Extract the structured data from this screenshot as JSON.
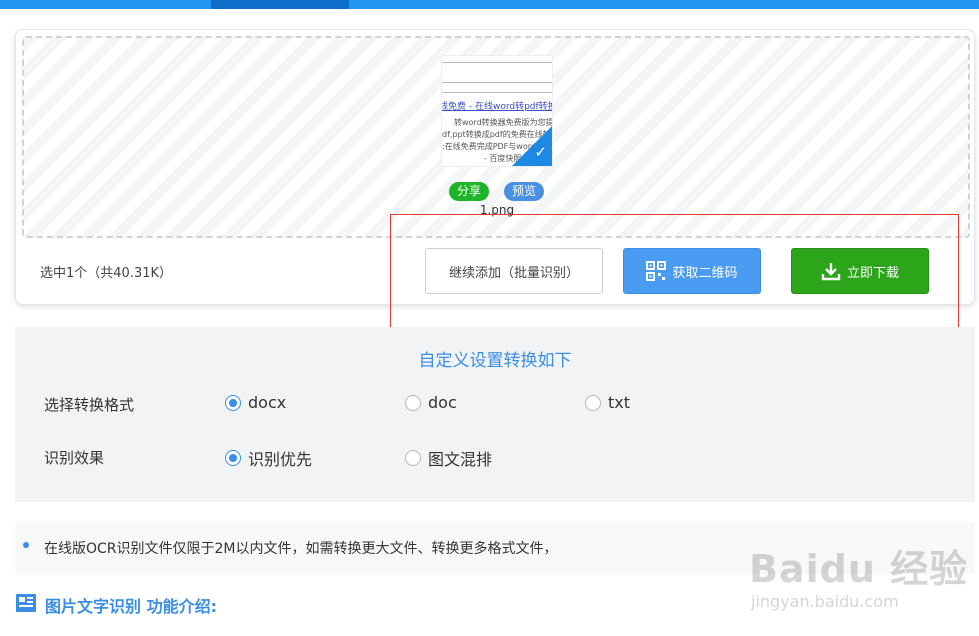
{
  "colors": {
    "primary": "#2196f3",
    "share_green": "#1db427",
    "preview_blue": "#4a90e2",
    "qr_button": "#4a9cf3",
    "download_button": "#2ca51b",
    "highlight_box": "#e53935",
    "heading_blue": "#3a8ee6"
  },
  "thumbnail": {
    "lines": [
      "线免费 - 在线word转pdf转换",
      "转word转换器免费版为您提供",
      "df,ppt转换成pdf的免费在线转换",
      ":在线免费完成PDF与word",
      "- 百度快照"
    ]
  },
  "upload": {
    "share_label": "分享",
    "preview_label": "预览",
    "filename": "1.png",
    "selected_info": "选中1个（共40.31K）",
    "add_more_label": "继续添加（批量识别）",
    "qr_label": "获取二维码",
    "download_label": "立即下载"
  },
  "settings": {
    "heading": "自定义设置转换如下",
    "format_label": "选择转换格式",
    "formats": [
      {
        "label": "docx",
        "selected": true
      },
      {
        "label": "doc",
        "selected": false
      },
      {
        "label": "txt",
        "selected": false
      }
    ],
    "effect_label": "识别效果",
    "effects": [
      {
        "label": "识别优先",
        "selected": true
      },
      {
        "label": "图文混排",
        "selected": false
      }
    ]
  },
  "notice": {
    "text": "在线版OCR识别文件仅限于2M以内文件，如需转换更大文件、转换更多格式文件，"
  },
  "intro": {
    "title": "图片文字识别 功能介绍:"
  },
  "watermark": {
    "brand": "Baidu 经验",
    "url": "jingyan.baidu.com"
  }
}
